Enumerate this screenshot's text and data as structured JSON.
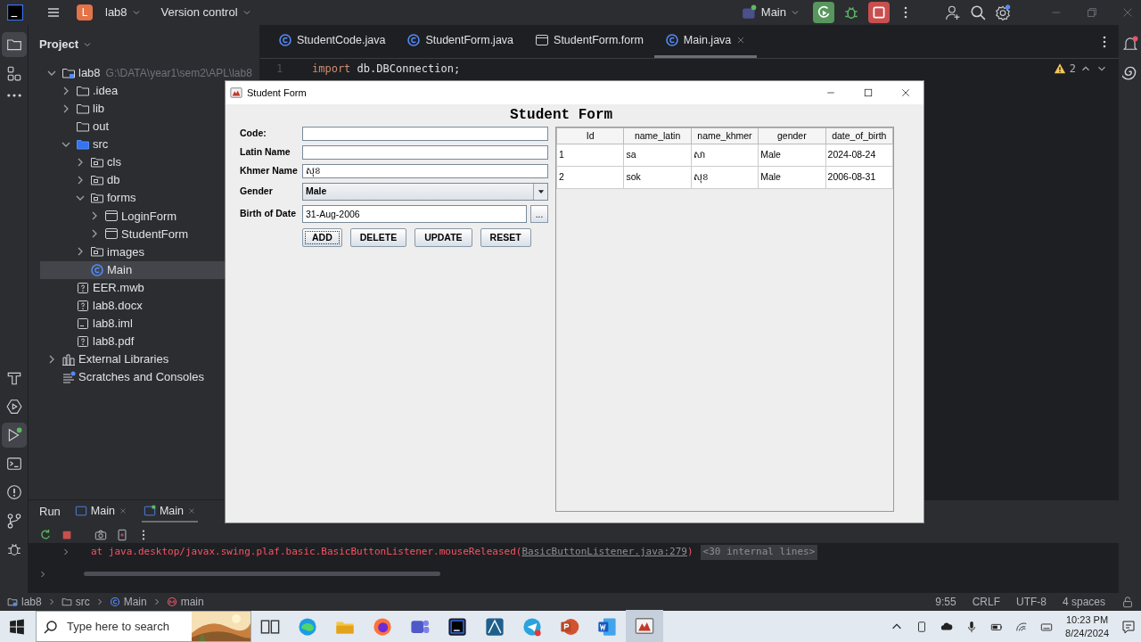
{
  "title_bar": {
    "project_initial": "L",
    "project": "lab8",
    "vcs": "Version control",
    "run_config": "Main"
  },
  "project_panel": {
    "title": "Project",
    "tree": [
      {
        "label": "lab8",
        "path": "G:\\DATA\\year1\\sem2\\APL\\lab8",
        "kind": "module",
        "expanded": true,
        "selected": false,
        "children": [
          {
            "label": ".idea",
            "kind": "folder",
            "expanded": false,
            "selected": false
          },
          {
            "label": "lib",
            "kind": "folder",
            "expanded": false,
            "selected": false
          },
          {
            "label": "out",
            "kind": "folder",
            "selected": false
          },
          {
            "label": "src",
            "kind": "source",
            "expanded": true,
            "selected": false,
            "children": [
              {
                "label": "cls",
                "kind": "package",
                "expanded": false,
                "selected": false
              },
              {
                "label": "db",
                "kind": "package",
                "expanded": false,
                "selected": false
              },
              {
                "label": "forms",
                "kind": "package",
                "expanded": true,
                "selected": false,
                "children": [
                  {
                    "label": "LoginForm",
                    "kind": "form",
                    "expanded": false,
                    "selected": false
                  },
                  {
                    "label": "StudentForm",
                    "kind": "form",
                    "expanded": false,
                    "selected": false
                  }
                ]
              },
              {
                "label": "images",
                "kind": "package",
                "expanded": false,
                "selected": false
              },
              {
                "label": "Main",
                "kind": "class",
                "selected": true
              }
            ]
          },
          {
            "label": "EER.mwb",
            "kind": "file",
            "selected": false
          },
          {
            "label": "lab8.docx",
            "kind": "file",
            "selected": false
          },
          {
            "label": "lab8.iml",
            "kind": "module-file",
            "selected": false
          },
          {
            "label": "lab8.pdf",
            "kind": "file",
            "selected": false
          }
        ]
      },
      {
        "label": "External Libraries",
        "kind": "library",
        "expanded": false,
        "selected": false
      },
      {
        "label": "Scratches and Consoles",
        "kind": "scratch",
        "selected": false
      }
    ]
  },
  "editor": {
    "tabs": [
      {
        "label": "StudentCode.java",
        "kind": "class",
        "selected": false
      },
      {
        "label": "StudentForm.java",
        "kind": "class",
        "selected": false
      },
      {
        "label": "StudentForm.form",
        "kind": "form",
        "selected": false
      },
      {
        "label": "Main.java",
        "kind": "class",
        "selected": true
      }
    ],
    "lines": [
      {
        "number": "1",
        "keyword": "import",
        "code": "db.DBConnection;"
      }
    ],
    "warnings": "2"
  },
  "run_panel": {
    "title": "Run",
    "tabs": [
      {
        "label": "Main",
        "selected": false
      },
      {
        "label": "Main",
        "selected": true
      }
    ],
    "console": [
      {
        "prefix": "at java.desktop/javax.swing.plaf.basic.BasicButtonListener.mouseReleased(",
        "link": "BasicButtonListener.java:279",
        "suffix": ")",
        "folded": "<30 internal lines>"
      }
    ]
  },
  "status_bar": {
    "breadcrumbs": [
      {
        "label": "lab8",
        "kind": "module"
      },
      {
        "label": "src",
        "kind": "folder"
      },
      {
        "label": "Main",
        "kind": "class"
      },
      {
        "label": "main",
        "kind": "method"
      }
    ],
    "items": [
      "9:55",
      "CRLF",
      "UTF-8",
      "4 spaces"
    ]
  },
  "dialog": {
    "title": "Student Form",
    "heading": "Student Form",
    "fields": [
      {
        "label": "Code:",
        "kind": "text"
      },
      {
        "label": "Latin Name",
        "kind": "text"
      },
      {
        "label": "Khmer Name",
        "kind": "text",
        "value": "សុខ"
      },
      {
        "label": "Gender",
        "kind": "select",
        "value": "Male"
      },
      {
        "label": "Birth of Date",
        "kind": "date",
        "value": "31-Aug-2006",
        "button": "..."
      }
    ],
    "buttons": [
      {
        "label": "ADD",
        "focused": true
      },
      {
        "label": "DELETE",
        "focused": false
      },
      {
        "label": "UPDATE",
        "focused": false
      },
      {
        "label": "RESET",
        "focused": false
      }
    ],
    "table": {
      "columns": [
        "Id",
        "name_latin",
        "name_khmer",
        "gender",
        "date_of_birth"
      ],
      "rows": [
        [
          "1",
          "sa",
          "សា",
          "Male",
          "2024-08-24"
        ],
        [
          "2",
          "sok",
          "សុខ",
          "Male",
          "2006-08-31"
        ]
      ]
    }
  },
  "taskbar": {
    "search_placeholder": "Type here to search",
    "apps": [
      {
        "kind": "task-view",
        "selected": false
      },
      {
        "kind": "edge",
        "selected": false
      },
      {
        "kind": "explorer",
        "selected": false
      },
      {
        "kind": "firefox",
        "selected": false
      },
      {
        "kind": "teams",
        "selected": false
      },
      {
        "kind": "jetbrains",
        "selected": false
      },
      {
        "kind": "diagram",
        "selected": false
      },
      {
        "kind": "telegram",
        "selected": false
      },
      {
        "kind": "powerpoint",
        "selected": false
      },
      {
        "kind": "word",
        "selected": false
      },
      {
        "kind": "java",
        "selected": true
      }
    ],
    "time": "10:23 PM",
    "date": "8/24/2024"
  }
}
